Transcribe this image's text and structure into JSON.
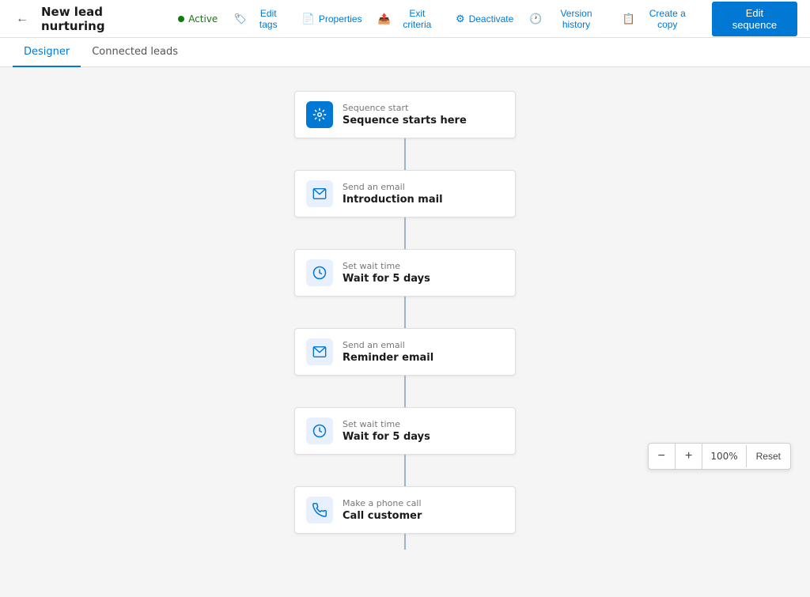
{
  "header": {
    "back_icon": "←",
    "title": "New lead nurturing",
    "status": "Active",
    "actions": [
      {
        "id": "edit-tags",
        "icon": "🏷",
        "label": "Edit tags"
      },
      {
        "id": "properties",
        "icon": "📄",
        "label": "Properties"
      },
      {
        "id": "exit-criteria",
        "icon": "📤",
        "label": "Exit criteria"
      },
      {
        "id": "deactivate",
        "icon": "⚙",
        "label": "Deactivate"
      },
      {
        "id": "version-history",
        "icon": "🕐",
        "label": "Version history"
      },
      {
        "id": "create-copy",
        "icon": "📋",
        "label": "Create a copy"
      }
    ],
    "edit_button": "Edit sequence"
  },
  "tabs": [
    {
      "id": "designer",
      "label": "Designer",
      "active": true
    },
    {
      "id": "connected-leads",
      "label": "Connected leads",
      "active": false
    }
  ],
  "flow": {
    "steps": [
      {
        "id": "sequence-start",
        "icon_type": "blue-bg",
        "icon": "⚙",
        "label": "Sequence start",
        "title": "Sequence starts here"
      },
      {
        "id": "send-email-1",
        "icon_type": "light-bg",
        "icon": "✉",
        "label": "Send an email",
        "title": "Introduction mail"
      },
      {
        "id": "wait-1",
        "icon_type": "wait-bg",
        "icon": "⏱",
        "label": "Set wait time",
        "title": "Wait for 5 days"
      },
      {
        "id": "send-email-2",
        "icon_type": "light-bg",
        "icon": "✉",
        "label": "Send an email",
        "title": "Reminder email"
      },
      {
        "id": "wait-2",
        "icon_type": "wait-bg",
        "icon": "⏱",
        "label": "Set wait time",
        "title": "Wait for 5 days"
      },
      {
        "id": "phone-call",
        "icon_type": "phone-bg",
        "icon": "📞",
        "label": "Make a phone call",
        "title": "Call customer"
      }
    ]
  },
  "zoom": {
    "minus": "−",
    "plus": "+",
    "level": "100%",
    "reset": "Reset"
  }
}
